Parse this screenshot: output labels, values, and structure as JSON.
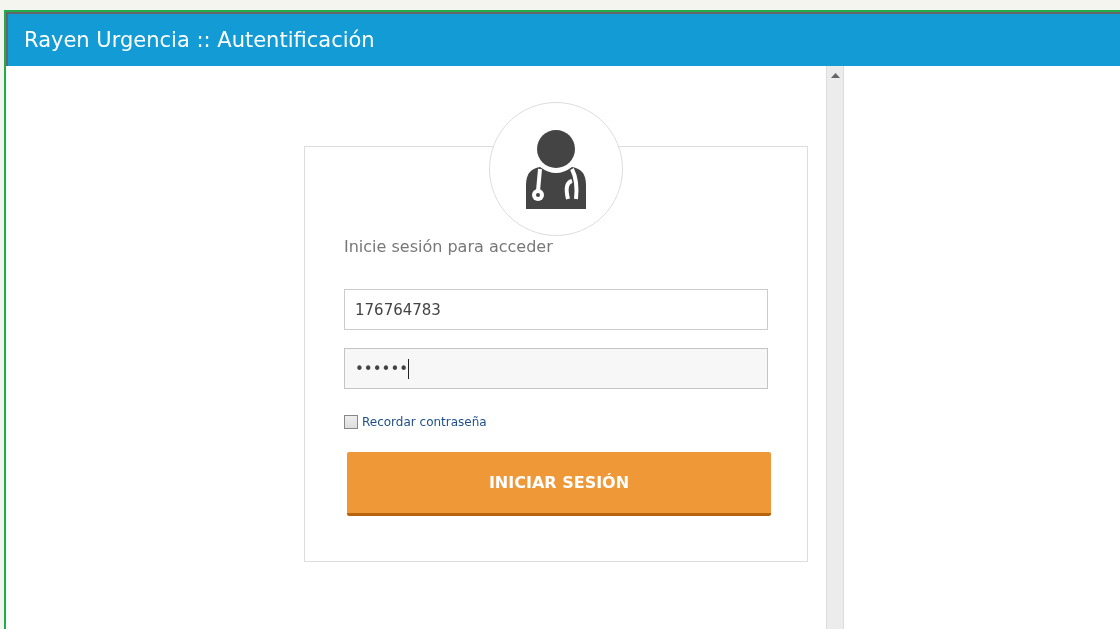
{
  "window": {
    "title": "Rayen Urgencia :: Autentificación"
  },
  "login": {
    "prompt": "Inicie sesión para acceder",
    "username": {
      "value": "176764783"
    },
    "password": {
      "value": "••••••",
      "focused": true
    },
    "remember": {
      "label": "Recordar contraseña",
      "checked": false
    },
    "submit": {
      "label": "INICIAR SESIÓN"
    }
  }
}
